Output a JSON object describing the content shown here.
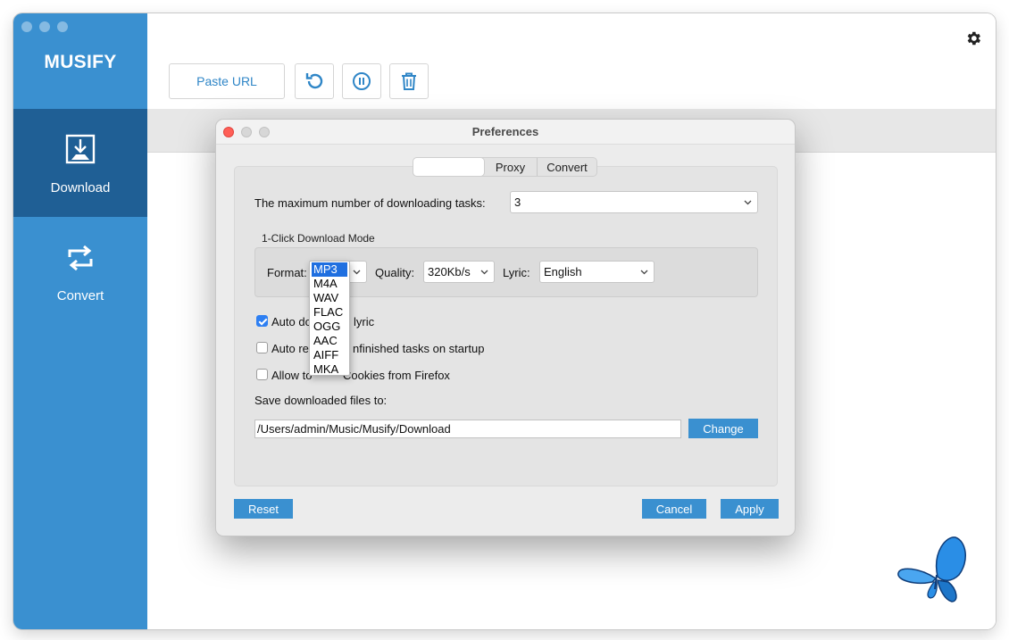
{
  "app": {
    "name": "MUSIFY",
    "nav": [
      {
        "label": "Download",
        "icon": "download-icon",
        "active": true
      },
      {
        "label": "Convert",
        "icon": "convert-icon",
        "active": false
      }
    ],
    "toolbar": {
      "paste_url_label": "Paste URL",
      "buttons": [
        "refresh-icon",
        "pause-icon",
        "trash-icon"
      ]
    },
    "settings_icon": "gear-icon"
  },
  "preferences": {
    "title": "Preferences",
    "tabs": [
      "",
      "Proxy",
      "Convert"
    ],
    "max_tasks_label": "The maximum number of downloading tasks:",
    "max_tasks_value": "3",
    "one_click_title": "1-Click Download Mode",
    "format_label": "Format:",
    "format_options": [
      "MP3",
      "M4A",
      "WAV",
      "FLAC",
      "OGG",
      "AAC",
      "AIFF",
      "MKA"
    ],
    "format_selected": "MP3",
    "quality_label": "Quality:",
    "quality_value": "320Kb/s",
    "lyric_label": "Lyric:",
    "lyric_value": "English",
    "checkboxes": [
      {
        "visible_text": "Auto do",
        "visible_text_after": "lyric",
        "checked": true
      },
      {
        "visible_text": "Auto re",
        "visible_text_after": "nfinished tasks on startup",
        "checked": false
      },
      {
        "visible_text": "Allow to",
        "visible_text_after": "Cookies from Firefox",
        "checked": false
      }
    ],
    "save_label": "Save downloaded files to:",
    "save_path": "/Users/admin/Music/Musify/Download",
    "change_label": "Change",
    "reset_label": "Reset",
    "cancel_label": "Cancel",
    "apply_label": "Apply"
  },
  "colors": {
    "sidebar": "#3a90d0",
    "sidebar_active": "#1f5f95",
    "button_blue": "#3a90d0",
    "accent_text": "#2f86c7"
  }
}
